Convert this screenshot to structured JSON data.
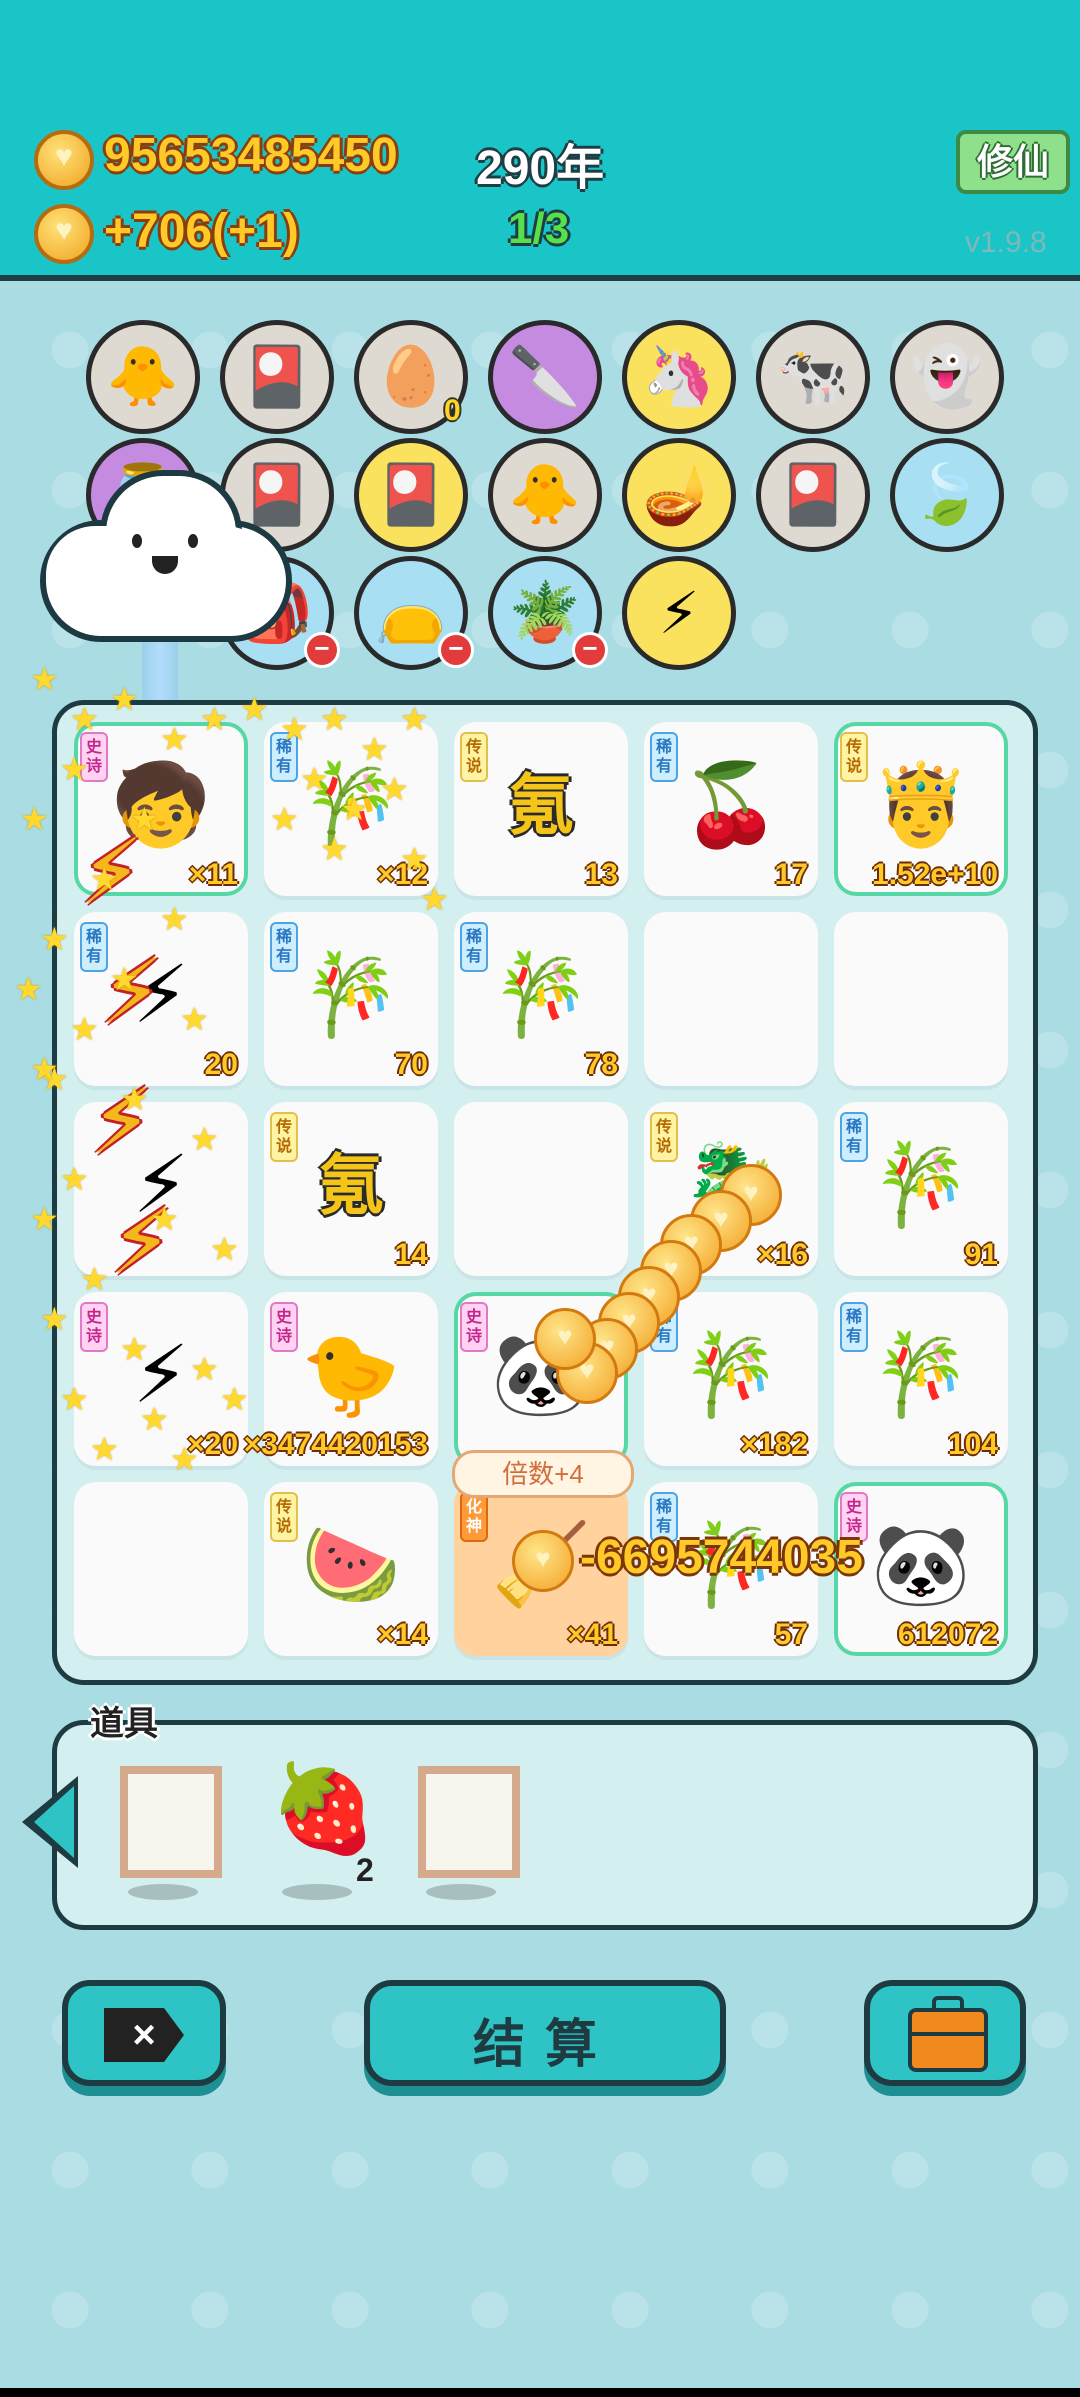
{
  "header": {
    "coins_total": "95653485450",
    "year": "290年",
    "income": "+706(+1)",
    "round": "1/3",
    "mode_button": "修仙",
    "version": "v1.9.8"
  },
  "symbol_row1": [
    {
      "name": "chick",
      "icon": "🐥",
      "color": "gray"
    },
    {
      "name": "pokeball-pack",
      "icon": "🎴",
      "color": "gray"
    },
    {
      "name": "egg-tray",
      "icon": "🥚",
      "color": "gray",
      "badge": "0"
    },
    {
      "name": "cleaver",
      "icon": "🔪",
      "color": "purple"
    },
    {
      "name": "unicorn",
      "icon": "🦄",
      "color": "yellow"
    },
    {
      "name": "cows",
      "icon": "🐄",
      "color": "gray"
    },
    {
      "name": "ghost",
      "icon": "👻",
      "color": "gray"
    }
  ],
  "symbol_row2": [
    {
      "name": "water-jar",
      "icon": "🫙",
      "color": "purple"
    },
    {
      "name": "pokeball-pack",
      "icon": "🎴",
      "color": "gray"
    },
    {
      "name": "pokeball-pack",
      "icon": "🎴",
      "color": "yellow"
    },
    {
      "name": "chick",
      "icon": "🐥",
      "color": "gray"
    },
    {
      "name": "magic-lamp",
      "icon": "🪔",
      "color": "yellow"
    },
    {
      "name": "pokeball-pack",
      "icon": "🎴",
      "color": "gray"
    },
    {
      "name": "leaf",
      "icon": "🍃",
      "color": "blue"
    }
  ],
  "symbol_row3": [
    {
      "name": "bag",
      "icon": "🎒",
      "color": "blue"
    },
    {
      "name": "sack",
      "icon": "👝",
      "color": "blue"
    },
    {
      "name": "flower-pot",
      "icon": "🪴",
      "color": "blue"
    },
    {
      "name": "lightning",
      "icon": "⚡",
      "color": "yellow"
    }
  ],
  "board": [
    [
      {
        "tag": "史诗",
        "tag_class": "epic",
        "icon": "🧒",
        "value": "×11",
        "style": "green"
      },
      {
        "tag": "稀有",
        "tag_class": "rare",
        "icon": "🎋",
        "value": "×12"
      },
      {
        "tag": "传说",
        "tag_class": "legend",
        "icon": "氪",
        "icon_text": true,
        "value": "13"
      },
      {
        "tag": "稀有",
        "tag_class": "rare",
        "icon": "🍒",
        "value": "17"
      },
      {
        "tag": "传说",
        "tag_class": "legend",
        "icon": "🤴",
        "value": "1.52e+10",
        "style": "green"
      }
    ],
    [
      {
        "tag": "稀有",
        "tag_class": "rare",
        "icon": "⚡",
        "value": "20"
      },
      {
        "tag": "稀有",
        "tag_class": "rare",
        "icon": "🎋",
        "value": "70"
      },
      {
        "tag": "稀有",
        "tag_class": "rare",
        "icon": "🎋",
        "value": "78"
      },
      {
        "tag": "",
        "tag_class": "",
        "icon": "",
        "value": ""
      },
      {
        "tag": "",
        "tag_class": "",
        "icon": "",
        "value": ""
      }
    ],
    [
      {
        "tag": "",
        "tag_class": "",
        "icon": "⚡",
        "value": ""
      },
      {
        "tag": "传说",
        "tag_class": "legend",
        "icon": "氪",
        "icon_text": true,
        "value": "14"
      },
      {
        "tag": "",
        "tag_class": "",
        "icon": "",
        "value": ""
      },
      {
        "tag": "传说",
        "tag_class": "legend",
        "icon": "🐉",
        "value": "×16"
      },
      {
        "tag": "稀有",
        "tag_class": "rare",
        "icon": "🎋",
        "value": "91"
      }
    ],
    [
      {
        "tag": "史诗",
        "tag_class": "epic",
        "icon": "⚡",
        "value": "×20"
      },
      {
        "tag": "史诗",
        "tag_class": "epic",
        "icon": "🐤",
        "value": "×3474420153"
      },
      {
        "tag": "史诗",
        "tag_class": "epic",
        "icon": "🐼",
        "value": "",
        "style": "green"
      },
      {
        "tag": "稀有",
        "tag_class": "rare",
        "icon": "🎋",
        "value": "×182"
      },
      {
        "tag": "稀有",
        "tag_class": "rare",
        "icon": "🎋",
        "value": "104"
      }
    ],
    [
      {
        "tag": "",
        "tag_class": "",
        "icon": "",
        "value": ""
      },
      {
        "tag": "传说",
        "tag_class": "legend",
        "icon": "🍉",
        "value": "×14"
      },
      {
        "tag": "化神",
        "tag_class": "god",
        "icon": "🧹",
        "value": "×41",
        "style": "orange"
      },
      {
        "tag": "稀有",
        "tag_class": "rare",
        "icon": "🎋",
        "value": "57"
      },
      {
        "tag": "史诗",
        "tag_class": "epic",
        "icon": "🐼",
        "value": "612072",
        "style": "green"
      }
    ]
  ],
  "effects": {
    "multiplier_tip": "倍数+4",
    "negative_value": "-6695744035"
  },
  "props": {
    "title": "道具",
    "items": [
      {
        "name": "empty-frame",
        "count": ""
      },
      {
        "name": "strawberry",
        "icon": "🍓",
        "count": "2"
      },
      {
        "name": "empty-frame",
        "count": ""
      }
    ]
  },
  "actions": {
    "settle_label": "结算"
  },
  "colors": {
    "topbar": "#19c5c6",
    "background": "#a9dde3",
    "accent_gold": "#ffc928",
    "dark_outline": "#1f3b42"
  }
}
